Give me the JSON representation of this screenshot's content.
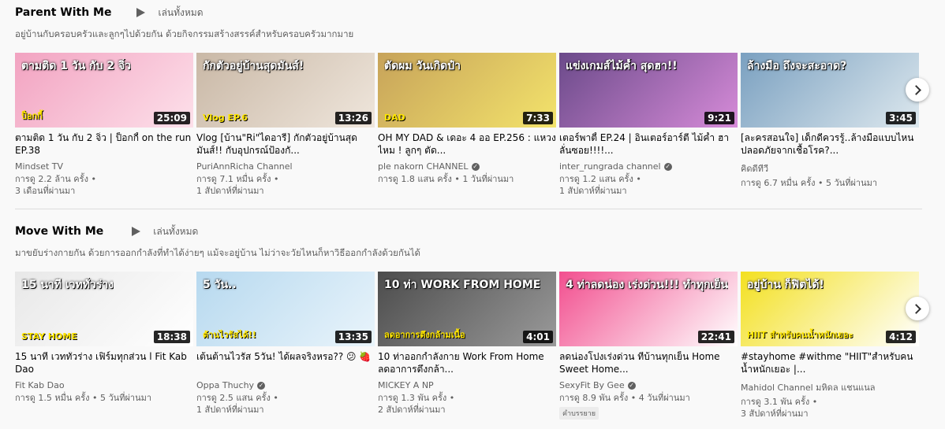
{
  "shelves": [
    {
      "title": "Parent With Me",
      "play_all": "เล่นทั้งหมด",
      "description": "อยู่บ้านกับครอบครัวและลูกๆไปด้วยกัน ด้วยกิจกรรมสร้างสรรค์สำหรับครอบครัวมากมาย",
      "videos": [
        {
          "thumb_text": "ตามติด 1 วัน กับ 2 จิ๋ว",
          "thumb_sub": "ป็อกกี้",
          "thumb_colors": [
            "#f2a3c1",
            "#fde0ea"
          ],
          "duration": "25:09",
          "title": "ตามติด 1 วัน กับ 2 จิ๋ว | ป็อกกี้ on the run EP.38",
          "channel": "Mindset TV",
          "verified": false,
          "views": "การดู 2.2 ล้าน ครั้ง •",
          "age": "3 เดือนที่ผ่านมา",
          "badge": ""
        },
        {
          "thumb_text": "กักตัวอยู่บ้านสุดมันส์!",
          "thumb_sub": "Vlog EP.6",
          "thumb_colors": [
            "#c9b8a6",
            "#efe6dc"
          ],
          "duration": "13:26",
          "title": "Vlog [บ้าน\"Ri\"ไดอารี่] กักตัวอยู่บ้านสุดมันส์!! กับอุปกรณ์ป้องกั...",
          "channel": "PuriAnnRicha Channel",
          "verified": false,
          "views": "การดู 7.1 หมื่น ครั้ง •",
          "age": "1 สัปดาห์ที่ผ่านมา",
          "badge": ""
        },
        {
          "thumb_text": "ตัดผม วันเกิดป๋า",
          "thumb_sub": "DAD",
          "thumb_colors": [
            "#c7a35a",
            "#f3e36b"
          ],
          "duration": "7:33",
          "title": "OH MY DAD & เดอะ 4 ออ EP.256 : แหวง ไหม ! ลูกๆ ตัด...",
          "channel": "ple nakorn CHANNEL",
          "verified": true,
          "views": "การดู 1.8 แสน ครั้ง • 1 วันที่ผ่านมา",
          "age": "",
          "badge": ""
        },
        {
          "thumb_text": "แข่งเกมส์ไม้ค้ำ สุดฮา!!",
          "thumb_sub": "",
          "thumb_colors": [
            "#6b4a8a",
            "#d68bd8"
          ],
          "duration": "9:21",
          "title": "เตอร์พาตี้ EP.24 | อินเตอร์อาร์ตี ไม้ค้ำ ฮาลั่นซอย!!!!...",
          "channel": "inter_rungrada channel",
          "verified": true,
          "views": "การดู 1.2 แสน ครั้ง •",
          "age": "1 สัปดาห์ที่ผ่านมา",
          "badge": ""
        },
        {
          "thumb_text": "ล้างมือ ถึงจะสะอาด?",
          "thumb_sub": "",
          "thumb_colors": [
            "#7aa0c0",
            "#dde8ee"
          ],
          "duration": "3:45",
          "title": "[ละครสอนใจ] เด็กดีควรรู้..ล้างมือแบบไหนปลอดภัยจากเชื้อโรค?...",
          "channel": "คิดดีทีวี",
          "verified": false,
          "views": "การดู 6.7 หมื่น ครั้ง • 5 วันที่ผ่านมา",
          "age": "",
          "badge": ""
        }
      ]
    },
    {
      "title": "Move With Me",
      "play_all": "เล่นทั้งหมด",
      "description": "มาขยับร่างกายกัน ด้วยการออกกำลังที่ทำได้ง่ายๆ แม้จะอยู่บ้าน ไม่ว่าจะวัยไหนก็หาวิธีออกกำลังด้วยกันได้",
      "videos": [
        {
          "thumb_text": "15 นาที เวททั่วร่าง",
          "thumb_sub": "STAY HOME",
          "thumb_colors": [
            "#e8e8e8",
            "#ffffff"
          ],
          "duration": "18:38",
          "title": "15 นาที เวททั่วร่าง เฟิร์มทุกส่วน l Fit Kab Dao",
          "channel": "Fit Kab Dao",
          "verified": false,
          "views": "การดู 1.5 หมื่น ครั้ง • 5 วันที่ผ่านมา",
          "age": "",
          "badge": ""
        },
        {
          "thumb_text": "5 วัน..",
          "thumb_sub": "ต้านไวรัสได้!!",
          "thumb_colors": [
            "#b7d9ef",
            "#e9f4fb"
          ],
          "duration": "13:35",
          "title": "เต้นต้านไวรัส 5วัน! ได้ผลจริงหรอ?? 😕 🍓",
          "channel": "Oppa Thuchy",
          "verified": true,
          "views": "การดู 2.5 แสน ครั้ง •",
          "age": "1 สัปดาห์ที่ผ่านมา",
          "badge": ""
        },
        {
          "thumb_text": "10 ท่า WORK FROM HOME",
          "thumb_sub": "ลดอาการตึงกล้ามเนื้อ",
          "thumb_colors": [
            "#4c4c4c",
            "#9a9a9a"
          ],
          "duration": "4:01",
          "title": "10 ท่าออกกำลังกาย Work From Home ลดอาการตึงกล้า...",
          "channel": "MICKEY A NP",
          "verified": false,
          "views": "การดู 1.3 พัน ครั้ง •",
          "age": "2 สัปดาห์ที่ผ่านมา",
          "badge": ""
        },
        {
          "thumb_text": "4 ท่าลดน่อง เร่งด่วน!!! ทำทุกเย็น",
          "thumb_sub": "",
          "thumb_colors": [
            "#f24f8f",
            "#ffffff"
          ],
          "duration": "22:41",
          "title": "ลดน่องโปงเร่งด่วน ที่บ้านทุกเย็น Home Sweet Home...",
          "channel": "SexyFit By Gee",
          "verified": true,
          "views": "การดู 8.9 พัน ครั้ง • 4 วันที่ผ่านมา",
          "age": "",
          "badge": "คำบรรยาย"
        },
        {
          "thumb_text": "อยู่บ้าน ก็ฟิตได้!",
          "thumb_sub": "HIIT สำหรับคนน้ำหนักเยอะ",
          "thumb_colors": [
            "#f3e020",
            "#ffffff"
          ],
          "duration": "4:12",
          "title": "#stayhome #withme \"HIIT\"สำหรับคนน้ำหนักเยอะ |...",
          "channel": "Mahidol Channel มหิดล แชนแนล",
          "verified": false,
          "views": "การดู 3.1 พัน ครั้ง •",
          "age": "3 สัปดาห์ที่ผ่านมา",
          "badge": ""
        }
      ]
    }
  ]
}
